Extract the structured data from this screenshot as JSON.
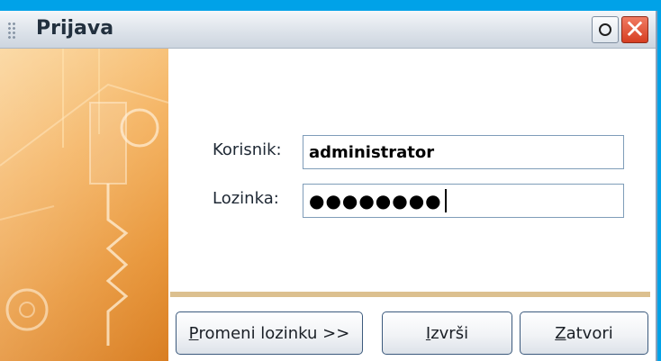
{
  "window": {
    "title": "Prijava",
    "restore_icon": "restore-circle-icon",
    "close_icon": "close-x-icon",
    "close_glyph": "✕"
  },
  "form": {
    "user_label": "Korisnik:",
    "user_value": "administrator",
    "password_label": "Lozinka:",
    "password_masked": "●●●●●●●●"
  },
  "buttons": {
    "change_password": {
      "hotkey": "P",
      "rest": "romeni lozinku >>"
    },
    "execute": {
      "hotkey": "I",
      "rest": "zvrši"
    },
    "close": {
      "hotkey": "Z",
      "rest": "atvori"
    }
  },
  "colors": {
    "desktop": "#00a2e8",
    "art_orange": "#f3a94c",
    "divider": "#dcc08f",
    "close_button": "#d63e22"
  }
}
